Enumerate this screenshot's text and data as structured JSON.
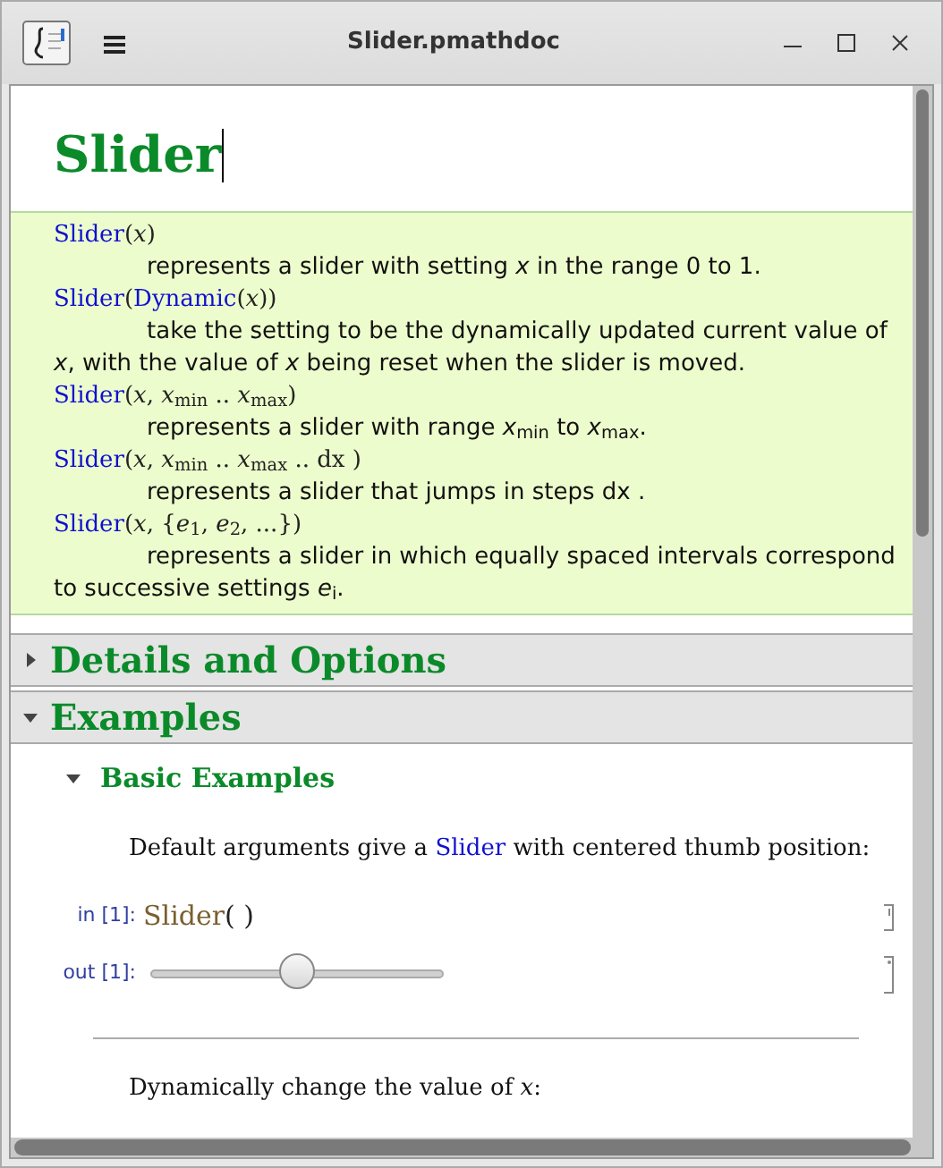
{
  "window": {
    "title": "Slider.pmathdoc"
  },
  "document": {
    "title": "Slider"
  },
  "usage": [
    {
      "signature": [
        {
          "kind": "link",
          "text": "Slider"
        },
        {
          "kind": "math",
          "text": "(*x*)"
        }
      ],
      "description": "represents a slider with setting *x* in the range 0 to 1."
    },
    {
      "signature": [
        {
          "kind": "link",
          "text": "Slider"
        },
        {
          "kind": "math",
          "text": "("
        },
        {
          "kind": "link",
          "text": "Dynamic"
        },
        {
          "kind": "math",
          "text": "(*x*))"
        }
      ],
      "description": "take the setting to be the dynamically updated current value of *x*, with the value of *x* being reset when the slider is moved."
    },
    {
      "signature": [
        {
          "kind": "link",
          "text": "Slider"
        },
        {
          "kind": "math",
          "text": "(*x*, *x*$_{min}$ .. *x*$_{max}$)"
        }
      ],
      "description": "represents a slider with range *x*$_{min}$ to *x*$_{max}$."
    },
    {
      "signature": [
        {
          "kind": "link",
          "text": "Slider"
        },
        {
          "kind": "math",
          "text": "(*x*, *x*$_{min}$ .. *x*$_{max}$ .. dx )"
        }
      ],
      "description": "represents a slider that jumps in steps dx ."
    },
    {
      "signature": [
        {
          "kind": "link",
          "text": "Slider"
        },
        {
          "kind": "math",
          "text": "(*x*, {*e*$_{1}$, *e*$_{2}$, ...})"
        }
      ],
      "description": "represents a slider in which equally spaced intervals correspond to successive settings *e*$_{i}$."
    }
  ],
  "sections": [
    {
      "title": "Details and Options",
      "expanded": false
    },
    {
      "title": "Examples",
      "expanded": true,
      "subsection": {
        "title": "Basic Examples",
        "expanded": true,
        "items": [
          {
            "kind": "text",
            "parts": [
              {
                "kind": "plain",
                "text": "Default arguments give a "
              },
              {
                "kind": "link",
                "text": "Slider"
              },
              {
                "kind": "plain",
                "text": " with centered thumb position:"
              }
            ]
          },
          {
            "kind": "input",
            "label": "in [1]:",
            "code": [
              {
                "kind": "symbol",
                "text": "Slider"
              },
              {
                "kind": "plain",
                "text": "( )"
              }
            ]
          },
          {
            "kind": "output",
            "label": "out [1]:",
            "level": 0.5
          },
          {
            "kind": "separator"
          },
          {
            "kind": "text",
            "parts": [
              {
                "kind": "plain",
                "text": "Dynamically change the value of *x*:"
              }
            ]
          }
        ]
      }
    }
  ]
}
